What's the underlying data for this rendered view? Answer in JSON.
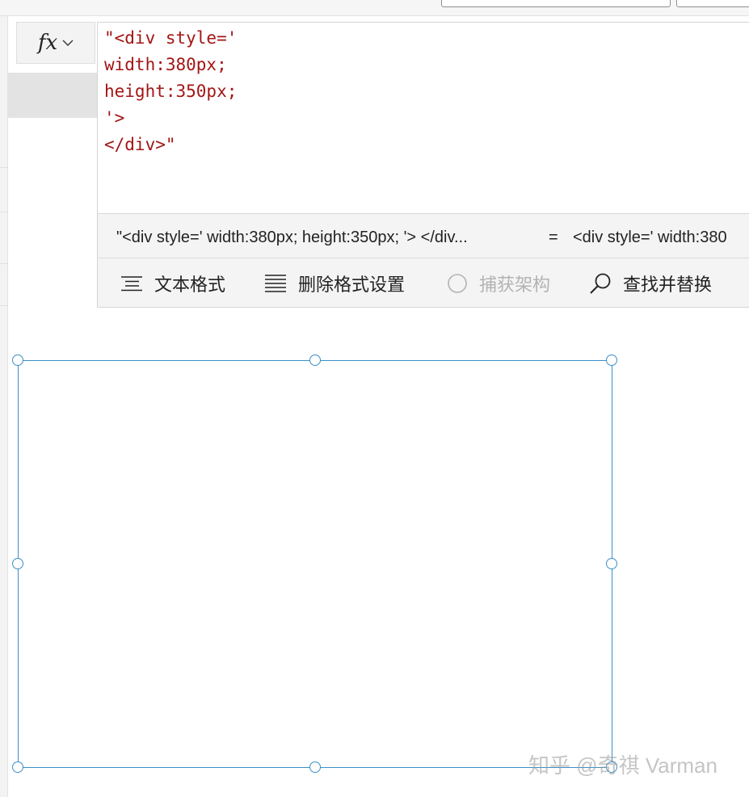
{
  "formula_bar": {
    "fx_label": "fx",
    "code_lines": [
      "\"<div style='",
      "width:380px;",
      "height:350px;",
      "'>",
      "</div>\""
    ],
    "preview": {
      "expression": "\"<div style=' width:380px; height:350px; '> </div...",
      "equals": "=",
      "result": "<div style=' width:380"
    }
  },
  "toolbar": {
    "format_text": "文本格式",
    "remove_formatting": "删除格式设置",
    "capture_schema": "捕获架构",
    "find_replace": "查找并替换"
  },
  "watermark": "知乎 @奇祺 Varman",
  "colors": {
    "code_text": "#a31515",
    "selection": "#3b8fc7",
    "toolbar_bg": "#f4f4f4",
    "disabled_text": "#b3b3b3"
  },
  "icons": {
    "fx_chevron": "chevron-down-icon",
    "format_text": "text-format-icon",
    "remove_formatting": "remove-formatting-icon",
    "capture_schema": "radio-circle-icon",
    "find_replace": "search-icon"
  }
}
